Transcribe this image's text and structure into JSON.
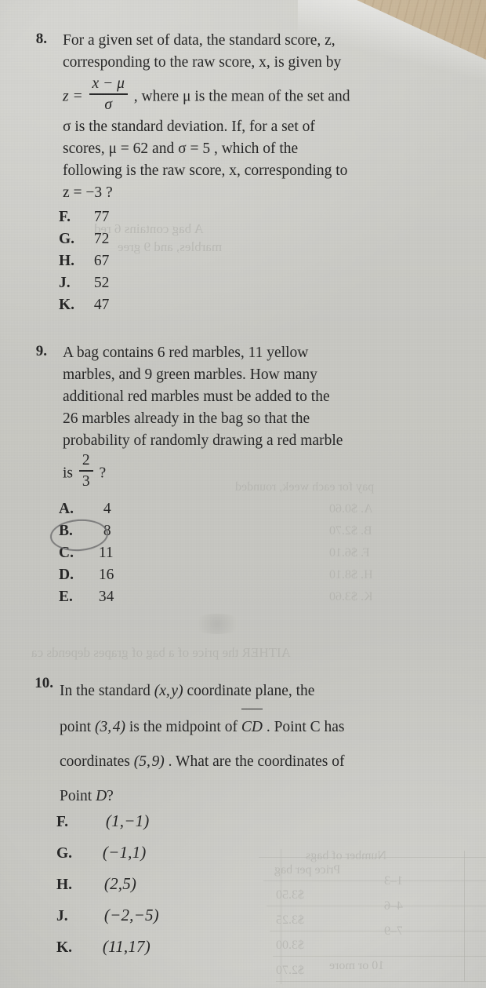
{
  "page": {
    "surface": "printed workbook page photographed on a wooden desk",
    "paper_color": "#c7c7c2",
    "wood_color": "#cbb99c",
    "ink_color": "#262626",
    "pencil_color": "#6f6f70"
  },
  "questions": [
    {
      "number": "8.",
      "stem_lines": [
        "For a given set of data, the standard score, z,",
        "corresponding to the raw score, x, is given by"
      ],
      "formula": {
        "lead": "z =",
        "numerator": "x − μ",
        "denominator": "σ",
        "trail": ", where μ is the mean of the set and"
      },
      "stem_lines_2": [
        "σ is the standard deviation. If, for a set of",
        "scores, μ = 62 and σ = 5 , which of the",
        "following is the raw score, x, corresponding to",
        "z = −3 ?"
      ],
      "choices": [
        {
          "label": "F.",
          "value": "77",
          "selected": false
        },
        {
          "label": "G.",
          "value": "72",
          "selected": false
        },
        {
          "label": "H.",
          "value": "67",
          "selected": false
        },
        {
          "label": "J.",
          "value": "52",
          "selected": false
        },
        {
          "label": "K.",
          "value": "47",
          "selected": false
        }
      ]
    },
    {
      "number": "9.",
      "stem_lines": [
        "A bag contains 6 red marbles, 11 yellow",
        "marbles, and 9 green marbles. How many",
        "additional red marbles must be added to the",
        "26 marbles already in the bag so that the",
        "probability of randomly drawing a red marble"
      ],
      "fraction_line": {
        "lead": "is",
        "numerator": "2",
        "denominator": "3",
        "trail": "?"
      },
      "choices": [
        {
          "label": "A.",
          "value": "4",
          "selected": false
        },
        {
          "label": "B.",
          "value": "8",
          "selected": true
        },
        {
          "label": "C.",
          "value": "11",
          "selected": false
        },
        {
          "label": "D.",
          "value": "16",
          "selected": false
        },
        {
          "label": "E.",
          "value": "34",
          "selected": false
        }
      ]
    },
    {
      "number": "10.",
      "stem_lines": [
        "In the standard (x, y) coordinate plane, the",
        "point (3, 4) is the midpoint of CD . Point C has",
        "coordinates (5, 9) . What are the coordinates of",
        "Point D?"
      ],
      "segment_label": "CD",
      "choices": [
        {
          "label": "F.",
          "value": "(1,−1)",
          "selected": false
        },
        {
          "label": "G.",
          "value": "(−1,1)",
          "selected": false
        },
        {
          "label": "H.",
          "value": "(2,5)",
          "selected": false
        },
        {
          "label": "J.",
          "value": "(−2,−5)",
          "selected": false
        },
        {
          "label": "K.",
          "value": "(11,17)",
          "selected": false
        }
      ]
    }
  ],
  "showthrough": {
    "note": "faint mirrored print bleeding through from the reverse side of the sheet",
    "lines": [
      "A bag contains 6 red",
      "marbles, and 9 gree",
      "pay for each week, rounded",
      "A. $0.60",
      "B. $2.70",
      "F. $6.10",
      "H. $8.10",
      "K. $3.60",
      "AITHER the price of a bag of grapes depends ca",
      "Number of bags",
      "1–3",
      "4–6",
      "7–9",
      "10 or more",
      "Price per bag",
      "$3.50",
      "$3.25",
      "$3.00",
      "$2.70"
    ]
  }
}
